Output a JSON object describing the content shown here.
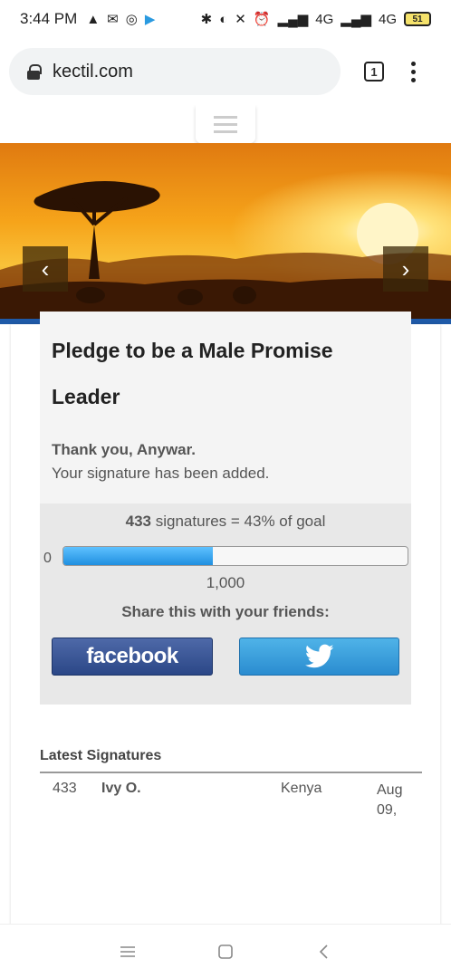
{
  "status_bar": {
    "time": "3:44 PM",
    "network_left": "4G",
    "network_right": "4G",
    "battery": "51"
  },
  "browser": {
    "url": "kectil.com",
    "tab_count": "1"
  },
  "carousel": {
    "prev_label": "‹",
    "next_label": "›"
  },
  "petition": {
    "title": "Pledge to be a Male Promise Leader",
    "thanks": "Thank you, Anywar.",
    "confirmation": "Your signature has been added.",
    "signature_count": "433",
    "signature_suffix": "signatures = 43% of goal",
    "progress_fraction": 0.433,
    "progress_min": "0",
    "goal": "1,000",
    "share_label": "Share this with your friends:",
    "facebook_label": "facebook"
  },
  "latest_signatures": {
    "title": "Latest Signatures",
    "rows": [
      {
        "number": "433",
        "name": "Ivy O.",
        "country": "Kenya",
        "date": "Aug 09,"
      }
    ]
  },
  "colors": {
    "hero_stripe": "#1f5aa8",
    "progress_fill": "#1f8fe0",
    "facebook": "#3b5998",
    "twitter": "#2a9ae0"
  }
}
